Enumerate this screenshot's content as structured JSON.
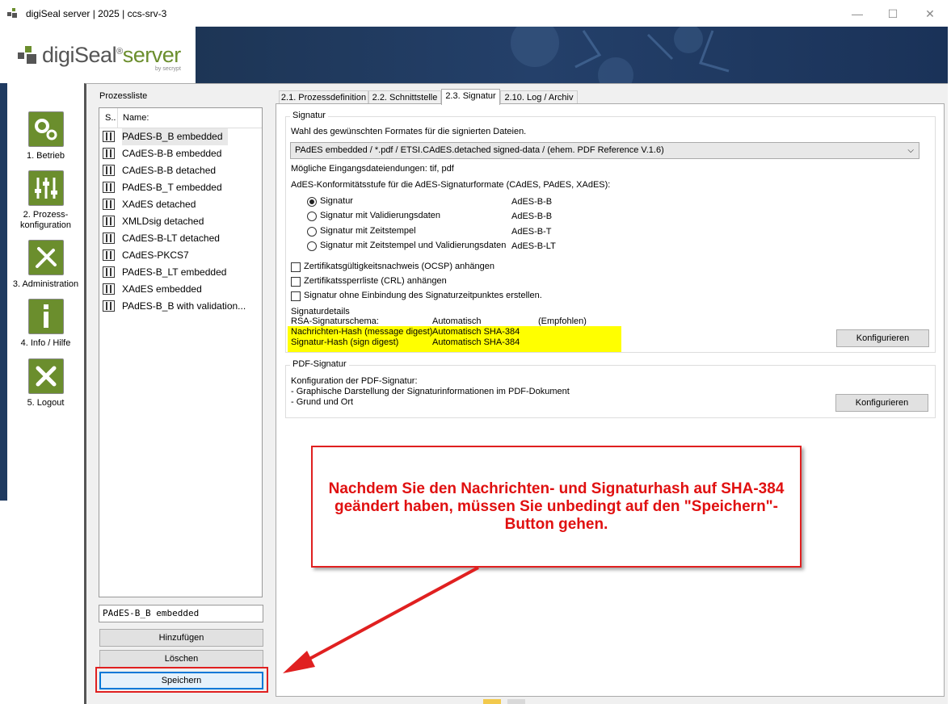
{
  "window": {
    "title": "digiSeal server | 2025 | ccs-srv-3",
    "minimize_label": "—",
    "maximize_label": "☐",
    "close_label": "✕"
  },
  "brand": {
    "name_prefix": "digiSeal",
    "name_suffix": "server",
    "registered": "®",
    "by": "by secrypt",
    "accent_color": "#6b8e2d"
  },
  "nav": {
    "items": [
      {
        "label": "1. Betrieb",
        "icon": "gears-icon"
      },
      {
        "label": "2. Prozess-konfiguration",
        "label_line1": "2. Prozess-",
        "label_line2": "konfiguration",
        "icon": "sliders-icon"
      },
      {
        "label": "3. Administration",
        "icon": "tools-icon"
      },
      {
        "label": "4. Info / Hilfe",
        "icon": "info-icon"
      },
      {
        "label": "5. Logout",
        "icon": "close-icon"
      }
    ]
  },
  "prozessliste": {
    "title": "Prozessliste",
    "col_status": "S..",
    "col_name": "Name:",
    "items": [
      "PAdES-B_B embedded",
      "CAdES-B-B embedded",
      "CAdES-B-B detached",
      "PAdES-B_T embedded",
      "XAdES detached",
      "XMLDsig detached",
      "CAdES-B-LT detached",
      "CAdES-PKCS7",
      "PAdES-B_LT embedded",
      "XAdES embedded",
      "PAdES-B_B with validation..."
    ],
    "selected_index": 0,
    "name_input_value": "PAdES-B_B embedded",
    "btn_add": "Hinzufügen",
    "btn_delete": "Löschen",
    "btn_save": "Speichern"
  },
  "tabs": [
    {
      "label": "2.1. Prozessdefinition",
      "active": false
    },
    {
      "label": "2.2. Schnittstelle",
      "active": false
    },
    {
      "label": "2.3. Signatur",
      "active": true
    },
    {
      "label": "2.10. Log / Archiv",
      "active": false
    }
  ],
  "signatur": {
    "group_title": "Signatur",
    "format_prompt": "Wahl des gewünschten Formates für die signierten Dateien.",
    "format_selected": "PAdES  embedded / *.pdf / ETSI.CAdES.detached signed-data / (ehem. PDF Reference V.1.6)",
    "extensions": "Mögliche Eingangsdateiendungen: tif, pdf",
    "conformance_prompt": "AdES-Konformitätsstufe für die AdES-Signaturformate (CAdES, PAdES, XAdES):",
    "levels": [
      {
        "label": "Signatur",
        "value": "AdES-B-B",
        "checked": true
      },
      {
        "label": "Signatur mit Validierungsdaten",
        "value": "AdES-B-B",
        "checked": false
      },
      {
        "label": "Signatur mit Zeitstempel",
        "value": "AdES-B-T",
        "checked": false
      },
      {
        "label": "Signatur mit Zeitstempel und Validierungsdaten",
        "value": "AdES-B-LT",
        "checked": false
      }
    ],
    "options": [
      {
        "label": "Zertifikatsgültigkeitsnachweis (OCSP) anhängen",
        "checked": false
      },
      {
        "label": "Zertifikatssperrliste (CRL) anhängen",
        "checked": false
      },
      {
        "label": "Signatur ohne Einbindung des Signaturzeitpunktes erstellen.",
        "checked": false
      }
    ],
    "details_title": "Signaturdetails",
    "details": [
      {
        "key": "RSA-Signaturschema:",
        "value": "Automatisch",
        "note": "(Empfohlen)"
      },
      {
        "key": "Nachrichten-Hash (message digest)",
        "value": "Automatisch SHA-384",
        "note": ""
      },
      {
        "key": "Signatur-Hash (sign digest)",
        "value": "Automatisch SHA-384",
        "note": ""
      }
    ],
    "btn_configure": "Konfigurieren"
  },
  "pdf_signatur": {
    "group_title": "PDF-Signatur",
    "line1": "Konfiguration der PDF-Signatur:",
    "line2": "- Graphische Darstellung der Signaturinformationen im PDF-Dokument",
    "line3": "- Grund und Ort",
    "btn_configure": "Konfigurieren"
  },
  "callout": {
    "text": "Nachdem Sie den Nachrichten- und Signaturhash auf SHA-384 geändert haben, müssen Sie unbedingt auf den \"Speichern\"-Button gehen.",
    "color": "#e01010"
  },
  "highlight_color": "#ffff00"
}
